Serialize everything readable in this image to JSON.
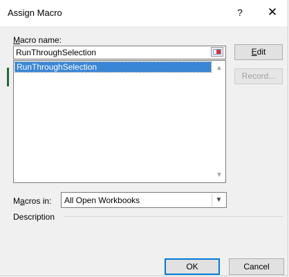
{
  "window": {
    "title": "Assign Macro",
    "help_label": "?",
    "close_label": "✕"
  },
  "macro_name": {
    "label_prefix": "",
    "label_accel": "M",
    "label_rest": "acro name:",
    "value": "RunThroughSelection"
  },
  "macro_list": {
    "items": [
      "RunThroughSelection"
    ],
    "selected_index": 0
  },
  "buttons": {
    "edit_accel": "E",
    "edit_rest": "dit",
    "record_label": "Record...",
    "ok_label": "OK",
    "cancel_label": "Cancel"
  },
  "macros_in": {
    "label_prefix": "M",
    "label_accel": "a",
    "label_rest": "cros in:",
    "selected": "All Open Workbooks"
  },
  "description": {
    "label": "Description"
  },
  "icons": {
    "refedit": "range-select-icon",
    "scroll_up": "chevron-up-icon",
    "scroll_down": "chevron-down-icon",
    "combo_arrow": "chevron-down-icon"
  },
  "colors": {
    "selection": "#3a86d6",
    "default_button_border": "#0078d7"
  }
}
